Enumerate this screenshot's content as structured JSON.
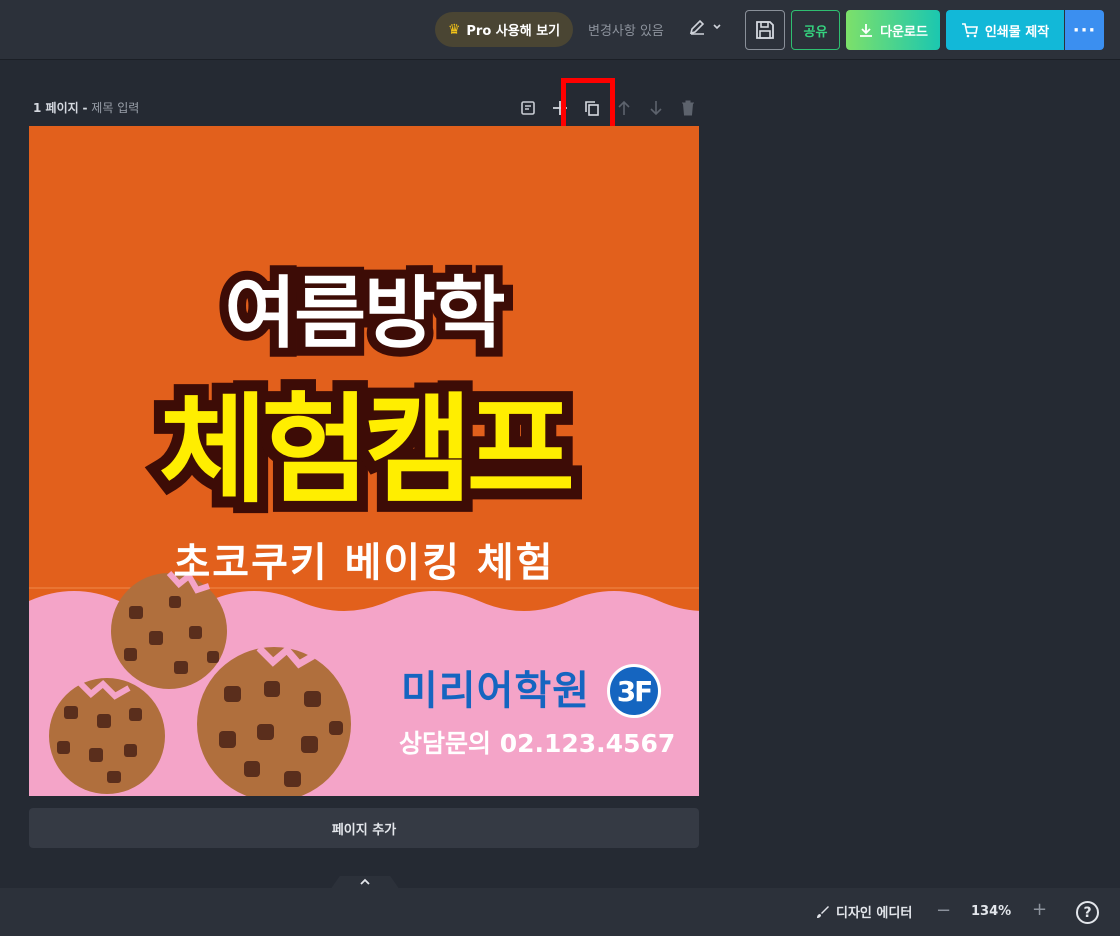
{
  "topbar": {
    "pro_label": "Pro 사용해 보기",
    "changes_label": "변경사항 있음",
    "share_label": "공유",
    "download_label": "다운로드",
    "print_label": "인쇄물 제작",
    "more_label": "···"
  },
  "page": {
    "number_label": "1 페이지",
    "separator": "-",
    "title_placeholder": "제목 입력"
  },
  "design": {
    "line1": "여름방학",
    "line2": "체험캠프",
    "line3": "초코쿠키 베이킹 체험",
    "academy": "미리어학원",
    "floor": "3F",
    "contact": "상담문의 02.123.4567",
    "colors": {
      "orange": "#e2601c",
      "pink": "#f4a4c8",
      "yellow": "#ffee00",
      "blue": "#1565c0",
      "outline": "#3d0c06"
    }
  },
  "add_page_label": "페이지 추가",
  "bottombar": {
    "design_editor_label": "디자인 에디터",
    "zoom_value": "134%",
    "zoom_minus": "−",
    "zoom_plus": "+",
    "help": "?"
  },
  "icons": {
    "crown": "crown-icon",
    "pen": "pen-icon",
    "save": "save-icon",
    "download": "download-icon",
    "cart": "cart-icon",
    "note": "note-icon",
    "add": "plus-icon",
    "duplicate": "duplicate-icon",
    "up": "arrow-up-icon",
    "down": "arrow-down-icon",
    "delete": "trash-icon"
  }
}
